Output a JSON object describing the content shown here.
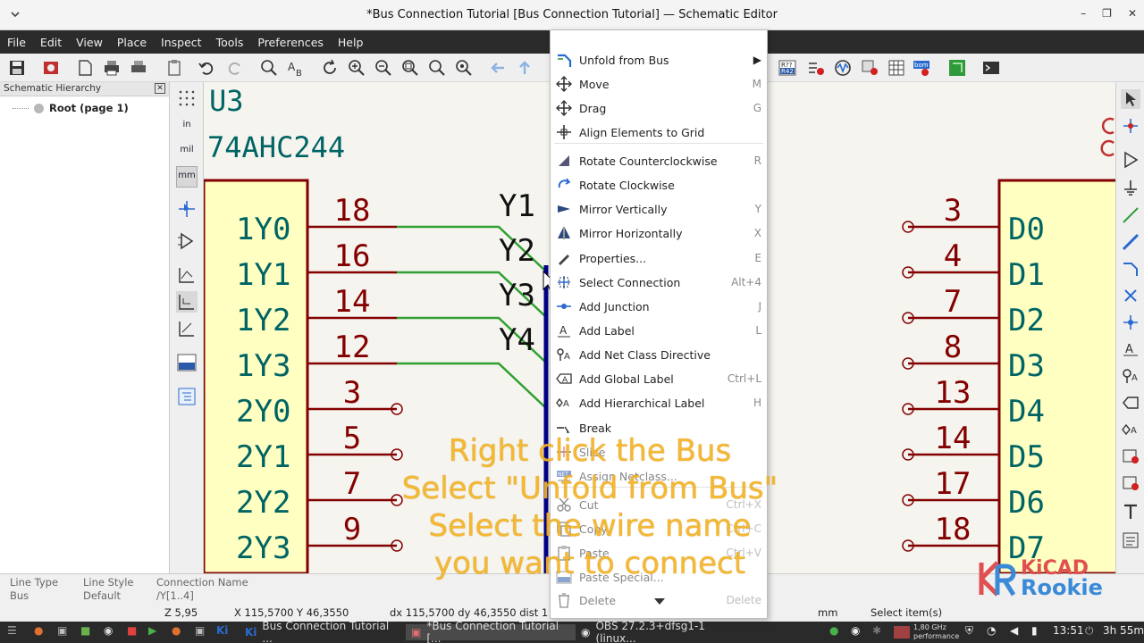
{
  "window": {
    "title": "*Bus Connection Tutorial [Bus Connection Tutorial] — Schematic Editor"
  },
  "menubar": [
    "File",
    "Edit",
    "View",
    "Place",
    "Inspect",
    "Tools",
    "Preferences",
    "Help"
  ],
  "hierarchy": {
    "title": "Schematic Hierarchy",
    "root": "Root (page 1)"
  },
  "left_toolbar": {
    "units_in": "in",
    "units_mil": "mil",
    "units_mm": "mm"
  },
  "schematic": {
    "ref": "U3",
    "value": "74AHC244",
    "left_pins": [
      {
        "name": "1Y0",
        "num": "18"
      },
      {
        "name": "1Y1",
        "num": "16"
      },
      {
        "name": "1Y2",
        "num": "14"
      },
      {
        "name": "1Y3",
        "num": "12"
      },
      {
        "name": "2Y0",
        "num": "3"
      },
      {
        "name": "2Y1",
        "num": "5"
      },
      {
        "name": "2Y2",
        "num": "7"
      },
      {
        "name": "2Y3",
        "num": "9"
      }
    ],
    "bus_labels": [
      "Y1",
      "Y2",
      "Y3",
      "Y4"
    ],
    "right_pins": [
      {
        "name": "D0",
        "num": "3"
      },
      {
        "name": "D1",
        "num": "4"
      },
      {
        "name": "D2",
        "num": "7"
      },
      {
        "name": "D3",
        "num": "8"
      },
      {
        "name": "D4",
        "num": "13"
      },
      {
        "name": "D5",
        "num": "14"
      },
      {
        "name": "D6",
        "num": "17"
      },
      {
        "name": "D7",
        "num": "18"
      }
    ],
    "colors": {
      "body_fill": "#ffffc2",
      "body_line": "#840000",
      "pin_text": "#006464",
      "wire": "#30a030",
      "bus": "#000084"
    }
  },
  "context_menu": {
    "items": [
      {
        "label": "Unfold from Bus",
        "shortcut": "",
        "icon": "unfold-bus-icon",
        "submenu": true
      },
      {
        "label": "Move",
        "shortcut": "M",
        "icon": "move-icon"
      },
      {
        "label": "Drag",
        "shortcut": "G",
        "icon": "drag-icon"
      },
      {
        "label": "Align Elements to Grid",
        "shortcut": "",
        "icon": "align-grid-icon"
      },
      {
        "label": "Rotate Counterclockwise",
        "shortcut": "R",
        "icon": "rotate-ccw-icon"
      },
      {
        "label": "Rotate Clockwise",
        "shortcut": "",
        "icon": "rotate-cw-icon"
      },
      {
        "label": "Mirror Vertically",
        "shortcut": "Y",
        "icon": "mirror-v-icon"
      },
      {
        "label": "Mirror Horizontally",
        "shortcut": "X",
        "icon": "mirror-h-icon"
      },
      {
        "label": "Properties...",
        "shortcut": "E",
        "icon": "properties-icon"
      },
      {
        "label": "Select Connection",
        "shortcut": "Alt+4",
        "icon": "select-connection-icon"
      },
      {
        "label": "Add Junction",
        "shortcut": "J",
        "icon": "junction-icon"
      },
      {
        "label": "Add Label",
        "shortcut": "L",
        "icon": "label-icon"
      },
      {
        "label": "Add Net Class Directive",
        "shortcut": "",
        "icon": "netclass-directive-icon"
      },
      {
        "label": "Add Global Label",
        "shortcut": "Ctrl+L",
        "icon": "global-label-icon"
      },
      {
        "label": "Add Hierarchical Label",
        "shortcut": "H",
        "icon": "hier-label-icon"
      },
      {
        "label": "Break",
        "shortcut": "",
        "icon": "break-icon"
      },
      {
        "label": "Slice",
        "shortcut": "",
        "icon": "slice-icon"
      },
      {
        "label": "Assign Netclass...",
        "shortcut": "",
        "icon": "netclass-icon"
      },
      {
        "label": "Cut",
        "shortcut": "Ctrl+X",
        "icon": "cut-icon"
      },
      {
        "label": "Copy",
        "shortcut": "Ctrl+C",
        "icon": "copy-icon"
      },
      {
        "label": "Paste",
        "shortcut": "Ctrl+V",
        "icon": "paste-icon"
      },
      {
        "label": "Paste Special...",
        "shortcut": "",
        "icon": "paste-special-icon"
      },
      {
        "label": "Delete",
        "shortcut": "Delete",
        "icon": "delete-icon"
      }
    ]
  },
  "overlay": {
    "lines": [
      "Right click the Bus",
      "Select \"Unfold from Bus\"",
      "Select the wire name",
      "you want to connect"
    ],
    "logo_top": "KiCAD",
    "logo_bottom": "Rookie"
  },
  "status_bar": {
    "line_type_label": "Line Type",
    "line_type_value": "Bus",
    "line_style_label": "Line Style",
    "line_style_value": "Default",
    "conn_name_label": "Connection Name",
    "conn_name_value": "/Y[1..4]",
    "zoom": "Z 5,95",
    "xy": "X 115,5700  Y 46,3550",
    "dxdy": "dx 115,5700  dy 46,3550  dist 1",
    "units": "mm",
    "mode": "Select item(s)"
  },
  "taskbar": {
    "tasks": [
      "Bus Connection Tutorial ...",
      "*Bus Connection Tutorial [...",
      "OBS 27.2.3+dfsg1-1 (linux..."
    ],
    "cpu": "1,80 GHz",
    "cpu_mode": "performance",
    "time": "13:51",
    "battery": "3h 55m"
  }
}
